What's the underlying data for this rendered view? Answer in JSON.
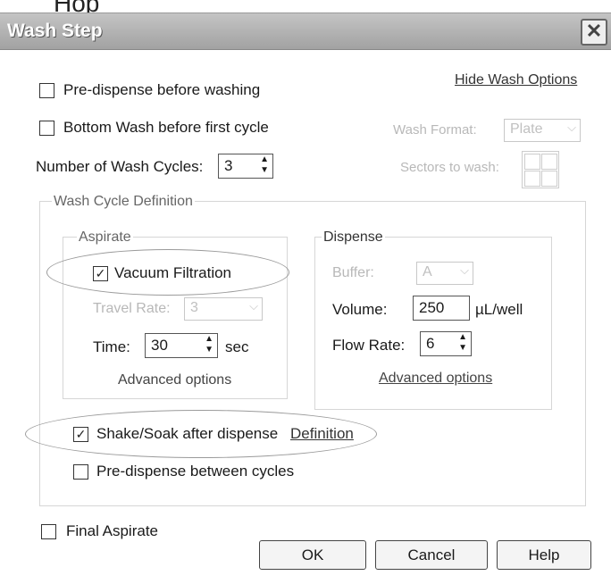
{
  "top_snippet": "Hop",
  "window": {
    "title": "Wash Step"
  },
  "hide_wash_options": "Hide Wash Options",
  "pre_dispense": {
    "label": "Pre-dispense before washing",
    "checked": false
  },
  "bottom_wash": {
    "label": "Bottom Wash before first cycle",
    "checked": false
  },
  "wash_format": {
    "label": "Wash Format:",
    "value": "Plate"
  },
  "sectors": {
    "label": "Sectors to wash:"
  },
  "wash_cycles": {
    "label": "Number of Wash Cycles:",
    "value": "3"
  },
  "cycle_def": {
    "title": "Wash Cycle Definition"
  },
  "aspirate": {
    "title": "Aspirate",
    "vacuum": {
      "label": "Vacuum Filtration",
      "checked": true
    },
    "travel_rate": {
      "label": "Travel Rate:",
      "value": "3"
    },
    "time": {
      "label": "Time:",
      "value": "30",
      "unit": "sec"
    },
    "advanced": "Advanced options"
  },
  "dispense": {
    "title": "Dispense",
    "buffer": {
      "label": "Buffer:",
      "value": "A"
    },
    "volume": {
      "label": "Volume:",
      "value": "250",
      "unit": "µL/well"
    },
    "flow_rate": {
      "label": "Flow Rate:",
      "value": "6"
    },
    "advanced": "Advanced options"
  },
  "shake_soak": {
    "label": "Shake/Soak after dispense",
    "checked": true,
    "link": "Definition"
  },
  "pre_dispense_between": {
    "label": "Pre-dispense between cycles",
    "checked": false
  },
  "final_aspirate": {
    "label": "Final Aspirate",
    "checked": false
  },
  "buttons": {
    "ok": "OK",
    "cancel": "Cancel",
    "help": "Help"
  },
  "icons": {
    "close": "close-icon",
    "check": "check-icon",
    "spin": "spin-arrows-icon",
    "dropdown": "chevron-down-icon"
  }
}
